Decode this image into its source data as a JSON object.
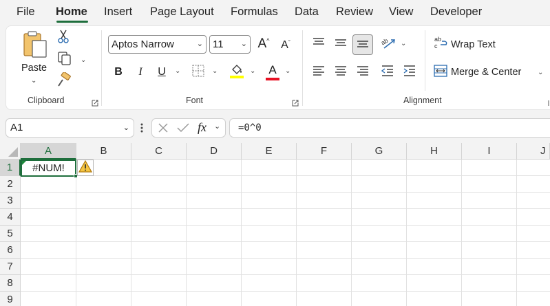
{
  "menu": {
    "tabs": [
      {
        "label": "File",
        "active": false
      },
      {
        "label": "Home",
        "active": true
      },
      {
        "label": "Insert",
        "active": false
      },
      {
        "label": "Page Layout",
        "active": false
      },
      {
        "label": "Formulas",
        "active": false
      },
      {
        "label": "Data",
        "active": false
      },
      {
        "label": "Review",
        "active": false
      },
      {
        "label": "View",
        "active": false
      },
      {
        "label": "Developer",
        "active": false
      }
    ]
  },
  "ribbon": {
    "clipboard": {
      "label": "Clipboard",
      "paste_label": "Paste"
    },
    "font": {
      "label": "Font",
      "font_name": "Aptos Narrow",
      "font_size": "11",
      "bold_glyph": "B",
      "italic_glyph": "I",
      "underline_glyph": "U",
      "grow_glyph": "A",
      "shrink_glyph": "A",
      "font_color_glyph": "A"
    },
    "alignment": {
      "label": "Alignment",
      "wrap_text": "Wrap Text",
      "merge_center": "Merge & Center"
    }
  },
  "formula_bar": {
    "name_box": "A1",
    "fx_label": "fx",
    "formula": "=0^0"
  },
  "grid": {
    "columns": [
      "A",
      "B",
      "C",
      "D",
      "E",
      "F",
      "G",
      "H",
      "I",
      "J"
    ],
    "rows": [
      "1",
      "2",
      "3",
      "4",
      "5",
      "6",
      "7",
      "8",
      "9"
    ],
    "selected_column": "A",
    "selected_row": "1",
    "active_cell_value": "#NUM!"
  },
  "colors": {
    "accent": "#1e6e3c",
    "highlight": "#ffff00",
    "font_color": "#e81123",
    "warning": "#e8a317"
  }
}
